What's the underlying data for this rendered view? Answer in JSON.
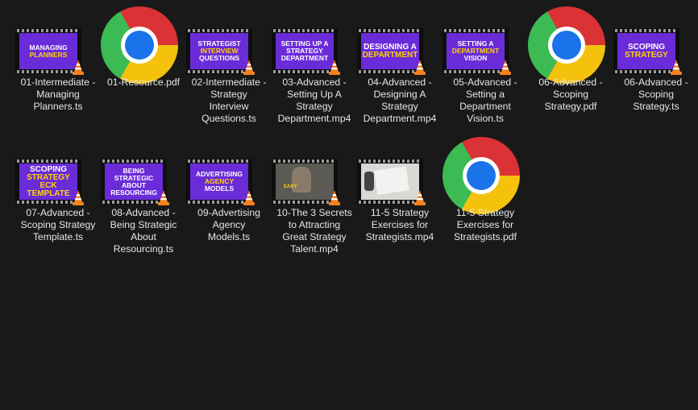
{
  "files": [
    {
      "name": "01-Intermediate - Managing Planners.ts",
      "label_lines": [
        "01-Intermediate -",
        "Managing",
        "Planners.ts"
      ],
      "type": "video",
      "thumb": {
        "style": "title",
        "lines": [
          {
            "text": "MANAGING",
            "color": "white"
          },
          {
            "text": "PLANNERS",
            "color": "yellow"
          }
        ]
      }
    },
    {
      "name": "01-Resource.pdf",
      "label_lines": [
        "01-Resource.pdf"
      ],
      "type": "pdf",
      "icon": "chrome-icon"
    },
    {
      "name": "02-Intermediate - Strategy Interview Questions.ts",
      "label_lines": [
        "02-Intermediate -",
        "Strategy",
        "Interview",
        "Questions.ts"
      ],
      "type": "video",
      "thumb": {
        "style": "title",
        "lines": [
          {
            "text": "STRATEGIST",
            "color": "white"
          },
          {
            "text": "INTERVIEW",
            "color": "yellow"
          },
          {
            "text": "QUESTIONS",
            "color": "white"
          }
        ]
      }
    },
    {
      "name": "03-Advanced - Setting Up A Strategy Department.mp4",
      "label_lines": [
        "03-Advanced -",
        "Setting Up A",
        "Strategy",
        "Department.mp4"
      ],
      "type": "video",
      "thumb": {
        "style": "title",
        "lines": [
          {
            "text": "SETTING UP A",
            "color": "white"
          },
          {
            "text": "STRATEGY",
            "color": "white"
          },
          {
            "text": "DEPARTMENT",
            "color": "white"
          }
        ]
      }
    },
    {
      "name": "04-Advanced - Designing A Strategy Department.mp4",
      "label_lines": [
        "04-Advanced -",
        "Designing A",
        "Strategy",
        "Department.mp4"
      ],
      "type": "video",
      "thumb": {
        "style": "title-big",
        "lines": [
          {
            "text": "DESIGNING A",
            "color": "white"
          },
          {
            "text": "DEPARTMENT",
            "color": "yellow"
          }
        ]
      }
    },
    {
      "name": "05-Advanced - Setting a Department Vision.ts",
      "label_lines": [
        "05-Advanced -",
        "Setting a",
        "Department",
        "Vision.ts"
      ],
      "type": "video",
      "thumb": {
        "style": "title",
        "lines": [
          {
            "text": "SETTING A",
            "color": "white"
          },
          {
            "text": "DEPARTMENT",
            "color": "yellow"
          },
          {
            "text": "VISION",
            "color": "white"
          }
        ]
      }
    },
    {
      "name": "06-Advanced - Scoping Strategy.pdf",
      "label_lines": [
        "06-Advanced -",
        "Scoping",
        "Strategy.pdf"
      ],
      "type": "pdf",
      "icon": "chrome-icon"
    },
    {
      "name": "06-Advanced - Scoping Strategy.ts",
      "label_lines": [
        "06-Advanced -",
        "Scoping",
        "Strategy.ts"
      ],
      "type": "video",
      "thumb": {
        "style": "title-big",
        "lines": [
          {
            "text": "SCOPING",
            "color": "white"
          },
          {
            "text": "STRATEGY",
            "color": "yellow"
          }
        ]
      }
    },
    {
      "name": "07-Advanced - Scoping Strategy Template.ts",
      "label_lines": [
        "07-Advanced -",
        "Scoping Strategy",
        "Template.ts"
      ],
      "type": "video",
      "thumb": {
        "style": "title-big",
        "lines": [
          {
            "text": "SCOPING",
            "color": "white"
          },
          {
            "text": "STRATEGY",
            "color": "yellow"
          },
          {
            "text": "ECK TEMPLATE",
            "color": "yellow"
          }
        ]
      }
    },
    {
      "name": "08-Advanced - Being Strategic About Resourcing.ts",
      "label_lines": [
        "08-Advanced -",
        "Being Strategic",
        "About",
        "Resourcing.ts"
      ],
      "type": "video",
      "thumb": {
        "style": "title",
        "lines": [
          {
            "text": "BEING STRATEGIC",
            "color": "white"
          },
          {
            "text": "ABOUT RESOURCING",
            "color": "white"
          }
        ]
      }
    },
    {
      "name": "09-Advertising Agency Models.ts",
      "label_lines": [
        "09-Advertising",
        "Agency",
        "Models.ts"
      ],
      "type": "video",
      "thumb": {
        "style": "title",
        "lines": [
          {
            "text": "ADVERTISING",
            "color": "white"
          },
          {
            "text": "AGENCY",
            "color": "yellow"
          },
          {
            "text": "MODELS",
            "color": "white"
          }
        ]
      }
    },
    {
      "name": "10-The 3 Secrets to Attracting Great Strategy Talent.mp4",
      "label_lines": [
        "10-The 3 Secrets",
        "to Attracting",
        "Great Strategy",
        "Talent.mp4"
      ],
      "type": "video",
      "thumb": {
        "style": "photo",
        "lines": []
      }
    },
    {
      "name": "11-5 Strategy Exercises for Strategists.mp4",
      "label_lines": [
        "11-5 Strategy",
        "Exercises for",
        "Strategists.mp4"
      ],
      "type": "video",
      "thumb": {
        "style": "whiteboard",
        "lines": []
      }
    },
    {
      "name": "11-5 Strategy Exercises for Strategists.pdf",
      "label_lines": [
        "11-5 Strategy",
        "Exercises for",
        "Strategists.pdf"
      ],
      "type": "pdf",
      "icon": "chrome-icon"
    }
  ],
  "colors": {
    "background": "#191919",
    "label": "#e6e6e6",
    "thumb_purple": "#6a2bd9",
    "thumb_yellow": "#ffd400",
    "vlc_orange": "#f58220"
  }
}
